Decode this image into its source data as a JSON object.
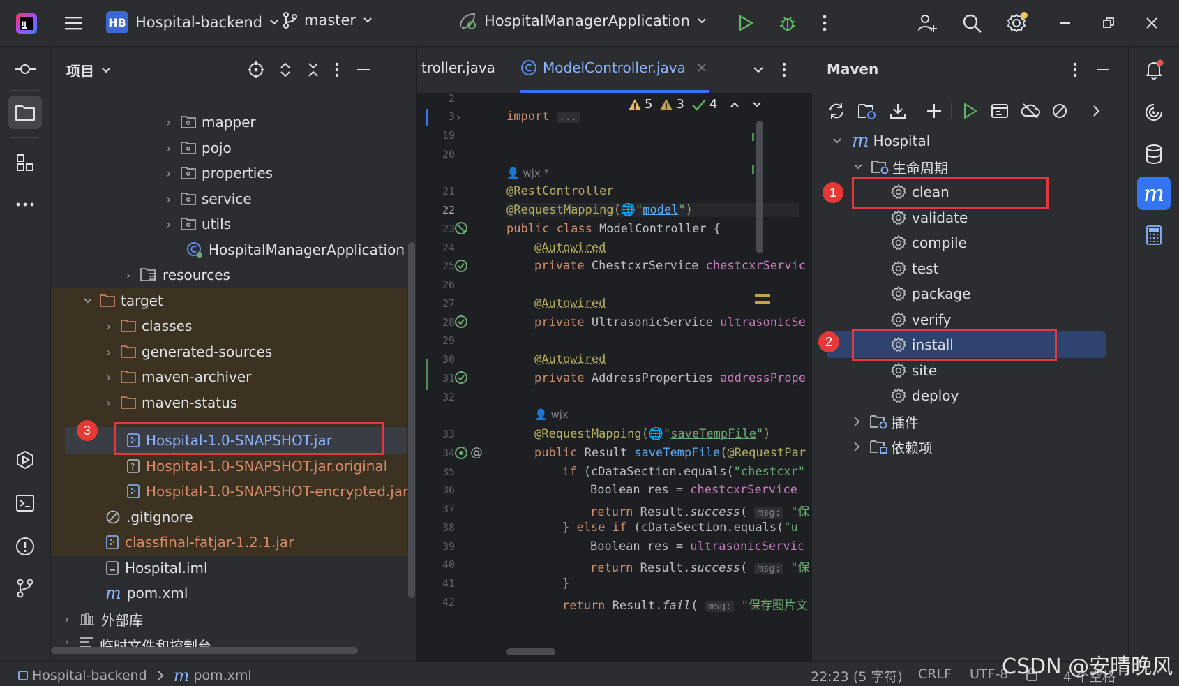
{
  "titlebar": {
    "project_badge": "HB",
    "project_name": "Hospital-backend",
    "branch": "master",
    "run_config": "HospitalManagerApplication"
  },
  "project_panel": {
    "title": "项目",
    "tree": [
      {
        "label": "mapper",
        "type": "package"
      },
      {
        "label": "pojo",
        "type": "package"
      },
      {
        "label": "properties",
        "type": "package"
      },
      {
        "label": "service",
        "type": "package"
      },
      {
        "label": "utils",
        "type": "package"
      },
      {
        "label": "HospitalManagerApplication",
        "type": "app-class"
      },
      {
        "label": "resources",
        "type": "resources"
      },
      {
        "label": "target",
        "type": "folder"
      },
      {
        "label": "classes",
        "type": "folder"
      },
      {
        "label": "generated-sources",
        "type": "folder"
      },
      {
        "label": "maven-archiver",
        "type": "folder"
      },
      {
        "label": "maven-status",
        "type": "folder"
      },
      {
        "label": "Hospital-1.0-SNAPSHOT.jar",
        "type": "jar"
      },
      {
        "label": "Hospital-1.0-SNAPSHOT.jar.original",
        "type": "unknown"
      },
      {
        "label": "Hospital-1.0-SNAPSHOT-encrypted.jar",
        "type": "jar"
      },
      {
        "label": ".gitignore",
        "type": "ignore"
      },
      {
        "label": "classfinal-fatjar-1.2.1.jar",
        "type": "jar"
      },
      {
        "label": "Hospital.iml",
        "type": "iml"
      },
      {
        "label": "pom.xml",
        "type": "maven"
      },
      {
        "label": "外部库",
        "type": "library"
      },
      {
        "label": "临时文件和控制台",
        "type": "scratch"
      }
    ]
  },
  "editor": {
    "tab_prev": "troller.java",
    "tab_active": "ModelController.java",
    "inspections": {
      "errors": "5",
      "warnings": "3",
      "ok": "4"
    },
    "lines": [
      {
        "num": "2",
        "text": ""
      },
      {
        "num": "3",
        "text": "import ..."
      },
      {
        "num": "19",
        "text": ""
      },
      {
        "num": "20",
        "text": ""
      },
      {
        "num": "",
        "text": "wjx *"
      },
      {
        "num": "21",
        "text": "@RestController"
      },
      {
        "num": "22",
        "text": "@RequestMapping(\"model\")"
      },
      {
        "num": "23",
        "text": "public class ModelController {"
      },
      {
        "num": "24",
        "text": "@Autowired"
      },
      {
        "num": "25",
        "text": "private ChestcxrService chestcxrServic"
      },
      {
        "num": "26",
        "text": ""
      },
      {
        "num": "27",
        "text": "@Autowired"
      },
      {
        "num": "28",
        "text": "private UltrasonicService ultrasonicSe"
      },
      {
        "num": "29",
        "text": ""
      },
      {
        "num": "30",
        "text": "@Autowired"
      },
      {
        "num": "31",
        "text": "private AddressProperties addressPrope"
      },
      {
        "num": "32",
        "text": ""
      },
      {
        "num": "",
        "text": "wjx"
      },
      {
        "num": "33",
        "text": "@RequestMapping(\"saveTempFile\")"
      },
      {
        "num": "34",
        "text": "public Result saveTempFile(@RequestPar"
      },
      {
        "num": "35",
        "text": "if (cDataSection.equals(\"chestcxr\""
      },
      {
        "num": "36",
        "text": "Boolean res = chestcxrService"
      },
      {
        "num": "37",
        "text": "return Result.success( msg: \"保"
      },
      {
        "num": "38",
        "text": "} else if (cDataSection.equals(\"u"
      },
      {
        "num": "39",
        "text": "Boolean res = ultrasonicServic"
      },
      {
        "num": "40",
        "text": "return Result.success( msg: \"保"
      },
      {
        "num": "41",
        "text": "}"
      },
      {
        "num": "42",
        "text": "return Result.fail( msg: \"保存图片文"
      }
    ]
  },
  "maven": {
    "title": "Maven",
    "root": "Hospital",
    "lifecycle_label": "生命周期",
    "phases": [
      "clean",
      "validate",
      "compile",
      "test",
      "package",
      "verify",
      "install",
      "site",
      "deploy"
    ],
    "plugins_label": "插件",
    "deps_label": "依赖项"
  },
  "annotations": {
    "b1": "1",
    "b2": "2",
    "b3": "3"
  },
  "statusbar": {
    "project": "Hospital-backend",
    "file": "pom.xml",
    "position": "22:23 (5 字符)",
    "line_sep": "CRLF",
    "encoding": "UTF-8",
    "indent": "4 个空格",
    "watermark": "CSDN @安晴晚风"
  },
  "colors": {
    "accent": "#3574f0",
    "highlight_red": "#e0393e",
    "jar_orange": "#d98a6a"
  }
}
